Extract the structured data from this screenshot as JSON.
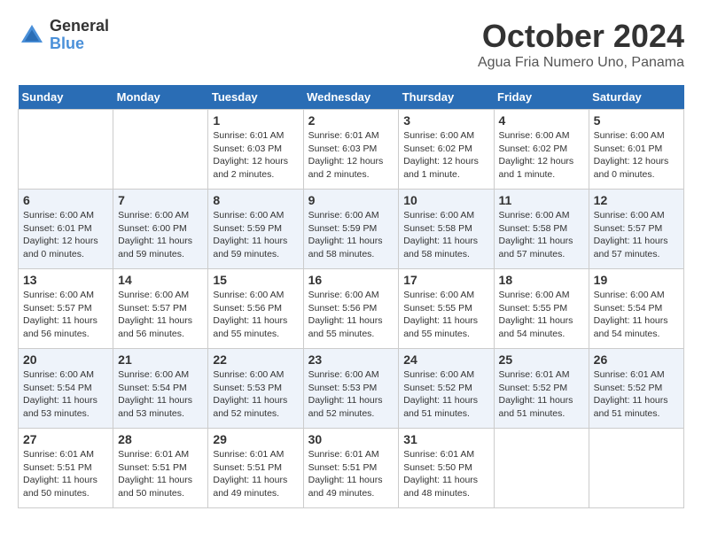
{
  "header": {
    "logo_general": "General",
    "logo_blue": "Blue",
    "month_title": "October 2024",
    "location": "Agua Fria Numero Uno, Panama"
  },
  "weekdays": [
    "Sunday",
    "Monday",
    "Tuesday",
    "Wednesday",
    "Thursday",
    "Friday",
    "Saturday"
  ],
  "weeks": [
    [
      {
        "day": "",
        "info": ""
      },
      {
        "day": "",
        "info": ""
      },
      {
        "day": "1",
        "info": "Sunrise: 6:01 AM\nSunset: 6:03 PM\nDaylight: 12 hours and 2 minutes."
      },
      {
        "day": "2",
        "info": "Sunrise: 6:01 AM\nSunset: 6:03 PM\nDaylight: 12 hours and 2 minutes."
      },
      {
        "day": "3",
        "info": "Sunrise: 6:00 AM\nSunset: 6:02 PM\nDaylight: 12 hours and 1 minute."
      },
      {
        "day": "4",
        "info": "Sunrise: 6:00 AM\nSunset: 6:02 PM\nDaylight: 12 hours and 1 minute."
      },
      {
        "day": "5",
        "info": "Sunrise: 6:00 AM\nSunset: 6:01 PM\nDaylight: 12 hours and 0 minutes."
      }
    ],
    [
      {
        "day": "6",
        "info": "Sunrise: 6:00 AM\nSunset: 6:01 PM\nDaylight: 12 hours and 0 minutes."
      },
      {
        "day": "7",
        "info": "Sunrise: 6:00 AM\nSunset: 6:00 PM\nDaylight: 11 hours and 59 minutes."
      },
      {
        "day": "8",
        "info": "Sunrise: 6:00 AM\nSunset: 5:59 PM\nDaylight: 11 hours and 59 minutes."
      },
      {
        "day": "9",
        "info": "Sunrise: 6:00 AM\nSunset: 5:59 PM\nDaylight: 11 hours and 58 minutes."
      },
      {
        "day": "10",
        "info": "Sunrise: 6:00 AM\nSunset: 5:58 PM\nDaylight: 11 hours and 58 minutes."
      },
      {
        "day": "11",
        "info": "Sunrise: 6:00 AM\nSunset: 5:58 PM\nDaylight: 11 hours and 57 minutes."
      },
      {
        "day": "12",
        "info": "Sunrise: 6:00 AM\nSunset: 5:57 PM\nDaylight: 11 hours and 57 minutes."
      }
    ],
    [
      {
        "day": "13",
        "info": "Sunrise: 6:00 AM\nSunset: 5:57 PM\nDaylight: 11 hours and 56 minutes."
      },
      {
        "day": "14",
        "info": "Sunrise: 6:00 AM\nSunset: 5:57 PM\nDaylight: 11 hours and 56 minutes."
      },
      {
        "day": "15",
        "info": "Sunrise: 6:00 AM\nSunset: 5:56 PM\nDaylight: 11 hours and 55 minutes."
      },
      {
        "day": "16",
        "info": "Sunrise: 6:00 AM\nSunset: 5:56 PM\nDaylight: 11 hours and 55 minutes."
      },
      {
        "day": "17",
        "info": "Sunrise: 6:00 AM\nSunset: 5:55 PM\nDaylight: 11 hours and 55 minutes."
      },
      {
        "day": "18",
        "info": "Sunrise: 6:00 AM\nSunset: 5:55 PM\nDaylight: 11 hours and 54 minutes."
      },
      {
        "day": "19",
        "info": "Sunrise: 6:00 AM\nSunset: 5:54 PM\nDaylight: 11 hours and 54 minutes."
      }
    ],
    [
      {
        "day": "20",
        "info": "Sunrise: 6:00 AM\nSunset: 5:54 PM\nDaylight: 11 hours and 53 minutes."
      },
      {
        "day": "21",
        "info": "Sunrise: 6:00 AM\nSunset: 5:54 PM\nDaylight: 11 hours and 53 minutes."
      },
      {
        "day": "22",
        "info": "Sunrise: 6:00 AM\nSunset: 5:53 PM\nDaylight: 11 hours and 52 minutes."
      },
      {
        "day": "23",
        "info": "Sunrise: 6:00 AM\nSunset: 5:53 PM\nDaylight: 11 hours and 52 minutes."
      },
      {
        "day": "24",
        "info": "Sunrise: 6:00 AM\nSunset: 5:52 PM\nDaylight: 11 hours and 51 minutes."
      },
      {
        "day": "25",
        "info": "Sunrise: 6:01 AM\nSunset: 5:52 PM\nDaylight: 11 hours and 51 minutes."
      },
      {
        "day": "26",
        "info": "Sunrise: 6:01 AM\nSunset: 5:52 PM\nDaylight: 11 hours and 51 minutes."
      }
    ],
    [
      {
        "day": "27",
        "info": "Sunrise: 6:01 AM\nSunset: 5:51 PM\nDaylight: 11 hours and 50 minutes."
      },
      {
        "day": "28",
        "info": "Sunrise: 6:01 AM\nSunset: 5:51 PM\nDaylight: 11 hours and 50 minutes."
      },
      {
        "day": "29",
        "info": "Sunrise: 6:01 AM\nSunset: 5:51 PM\nDaylight: 11 hours and 49 minutes."
      },
      {
        "day": "30",
        "info": "Sunrise: 6:01 AM\nSunset: 5:51 PM\nDaylight: 11 hours and 49 minutes."
      },
      {
        "day": "31",
        "info": "Sunrise: 6:01 AM\nSunset: 5:50 PM\nDaylight: 11 hours and 48 minutes."
      },
      {
        "day": "",
        "info": ""
      },
      {
        "day": "",
        "info": ""
      }
    ]
  ]
}
